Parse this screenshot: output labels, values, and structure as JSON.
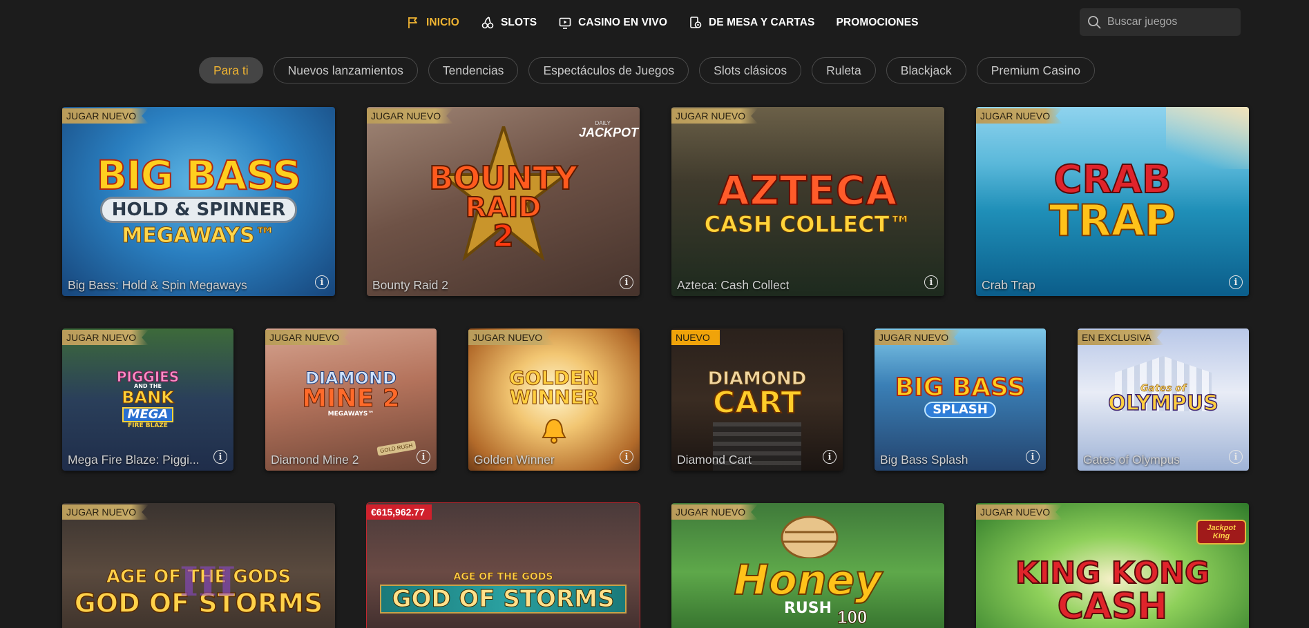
{
  "nav": {
    "items": [
      {
        "label": "INICIO",
        "icon": "flag-icon",
        "active": true
      },
      {
        "label": "SLOTS",
        "icon": "cherries-icon",
        "active": false
      },
      {
        "label": "CASINO EN VIVO",
        "icon": "live-tv-icon",
        "active": false
      },
      {
        "label": "DE MESA Y CARTAS",
        "icon": "cards-chip-icon",
        "active": false
      },
      {
        "label": "PROMOCIONES",
        "icon": "",
        "active": false
      }
    ],
    "search_placeholder": "Buscar juegos"
  },
  "pills": [
    {
      "label": "Para ti",
      "active": true
    },
    {
      "label": "Nuevos lanzamientos"
    },
    {
      "label": "Tendencias"
    },
    {
      "label": "Espectáculos de Juegos"
    },
    {
      "label": "Slots clásicos"
    },
    {
      "label": "Ruleta"
    },
    {
      "label": "Blackjack"
    },
    {
      "label": "Premium Casino"
    }
  ],
  "games_row1": [
    {
      "title": "Big Bass: Hold & Spin Megaways",
      "badge": "JUGAR NUEVO",
      "logo": [
        "BIG BASS",
        "HOLD & SPINNER",
        "MEGAWAYS™"
      ]
    },
    {
      "title": "Bounty Raid 2",
      "badge": "JUGAR NUEVO",
      "logo": [
        "BOUNTY",
        "RAID",
        "2"
      ],
      "corner": "JACKPOT",
      "corner_small": "DAILY"
    },
    {
      "title": "Azteca: Cash Collect",
      "badge": "JUGAR NUEVO",
      "logo": [
        "AZTECA",
        "CASH COLLECT™"
      ]
    },
    {
      "title": "Crab Trap",
      "badge": "JUGAR NUEVO",
      "logo": [
        "CRAB",
        "TRAP"
      ]
    }
  ],
  "games_row2": [
    {
      "title": "Mega Fire Blaze: Piggi...",
      "badge": "JUGAR NUEVO",
      "logo": [
        "PIGGIES",
        "BANK",
        "MEGA",
        "FIRE BLAZE"
      ],
      "logo_small": "AND THE"
    },
    {
      "title": "Diamond Mine 2",
      "badge": "JUGAR NUEVO",
      "logo": [
        "DIAMOND",
        "MINE 2",
        "MEGAWAYS™"
      ],
      "extra": "GOLD RUSH"
    },
    {
      "title": "Golden Winner",
      "badge": "JUGAR NUEVO",
      "logo": [
        "GOLDEN",
        "WINNER"
      ]
    },
    {
      "title": "Diamond Cart",
      "badge": "NUEVO",
      "logo": [
        "DIAMOND",
        "CART"
      ]
    },
    {
      "title": "Big Bass Splash",
      "badge": "JUGAR NUEVO",
      "logo": [
        "BIG BASS",
        "SPLASH"
      ]
    },
    {
      "title": "Gates of Olympus",
      "badge": "EN EXCLUSIVA",
      "logo": [
        "Gates of",
        "OLYMPUS"
      ]
    }
  ],
  "games_row3": [
    {
      "badge": "JUGAR NUEVO",
      "logo": [
        "AGE OF THE GODS",
        "GOD OF STORMS",
        "III"
      ]
    },
    {
      "badge": "€615,962.77",
      "logo": [
        "AGE OF THE GODS",
        "GOD OF STORMS"
      ]
    },
    {
      "badge": "JUGAR NUEVO",
      "logo": [
        "Honey",
        "RUSH",
        "100"
      ]
    },
    {
      "badge": "JUGAR NUEVO",
      "logo": [
        "KING KONG",
        "CASH"
      ],
      "corner": "Jackpot King"
    }
  ],
  "colors": {
    "background": "#1c1c1c",
    "accent": "#f0b432",
    "badge": "#c6aa66",
    "badge_new": "#f0a30a",
    "jackpot": "#d0202c"
  }
}
